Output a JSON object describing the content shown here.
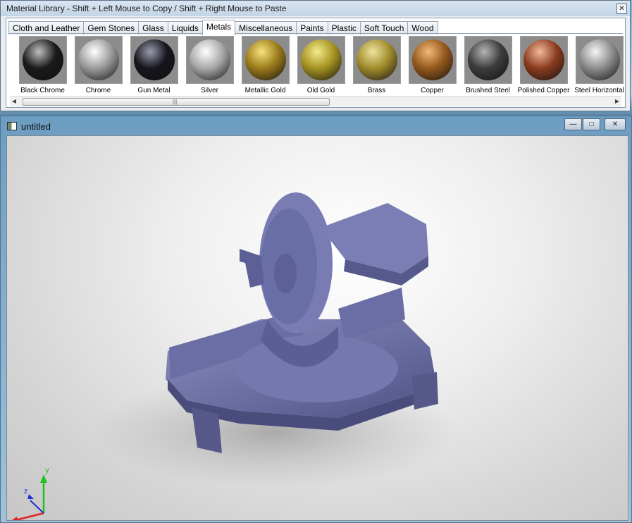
{
  "material_library": {
    "title": "Material Library - Shift + Left Mouse to Copy / Shift + Right Mouse to Paste",
    "close_glyph": "✕",
    "tabs": [
      {
        "label": "Cloth and Leather",
        "active": false
      },
      {
        "label": "Gem Stones",
        "active": false
      },
      {
        "label": "Glass",
        "active": false
      },
      {
        "label": "Liquids",
        "active": false
      },
      {
        "label": "Metals",
        "active": true
      },
      {
        "label": "Miscellaneous",
        "active": false
      },
      {
        "label": "Paints",
        "active": false
      },
      {
        "label": "Plastic",
        "active": false
      },
      {
        "label": "Soft Touch",
        "active": false
      },
      {
        "label": "Wood",
        "active": false
      }
    ],
    "materials": [
      {
        "label": "Black Chrome",
        "color": "#1a1a1a",
        "highlight": "#bfbfbf"
      },
      {
        "label": "Chrome",
        "color": "#9a9a9a",
        "highlight": "#ffffff"
      },
      {
        "label": "Gun Metal",
        "color": "#15151c",
        "highlight": "#9b9bb0"
      },
      {
        "label": "Silver",
        "color": "#a8a8a8",
        "highlight": "#ffffff"
      },
      {
        "label": "Metallic Gold",
        "color": "#9a7a1a",
        "highlight": "#f6e27a"
      },
      {
        "label": "Old Gold",
        "color": "#a69222",
        "highlight": "#f3ec8c"
      },
      {
        "label": "Brass",
        "color": "#a08c2c",
        "highlight": "#efe39c"
      },
      {
        "label": "Copper",
        "color": "#94581c",
        "highlight": "#f2b878"
      },
      {
        "label": "Brushed Steel",
        "color": "#3c3c3c",
        "highlight": "#b4b4b4"
      },
      {
        "label": "Polished Copper",
        "color": "#8a3c1e",
        "highlight": "#f4b89c"
      },
      {
        "label": "Steel Horizontal",
        "color": "#8c8c8c",
        "highlight": "#f4f4f4"
      }
    ],
    "scroll_left": "◀",
    "scroll_right": "▶",
    "scroll_grip": "|||"
  },
  "viewport_window": {
    "title": "untitled",
    "minimize_glyph": "—",
    "maximize_glyph": "□",
    "close_glyph": "✕",
    "model_color": "#6f73a8",
    "axes": {
      "x_color": "#e02020",
      "y_color": "#20c020",
      "z_color": "#2030d0",
      "y_label": "y",
      "z_label": "z"
    }
  }
}
